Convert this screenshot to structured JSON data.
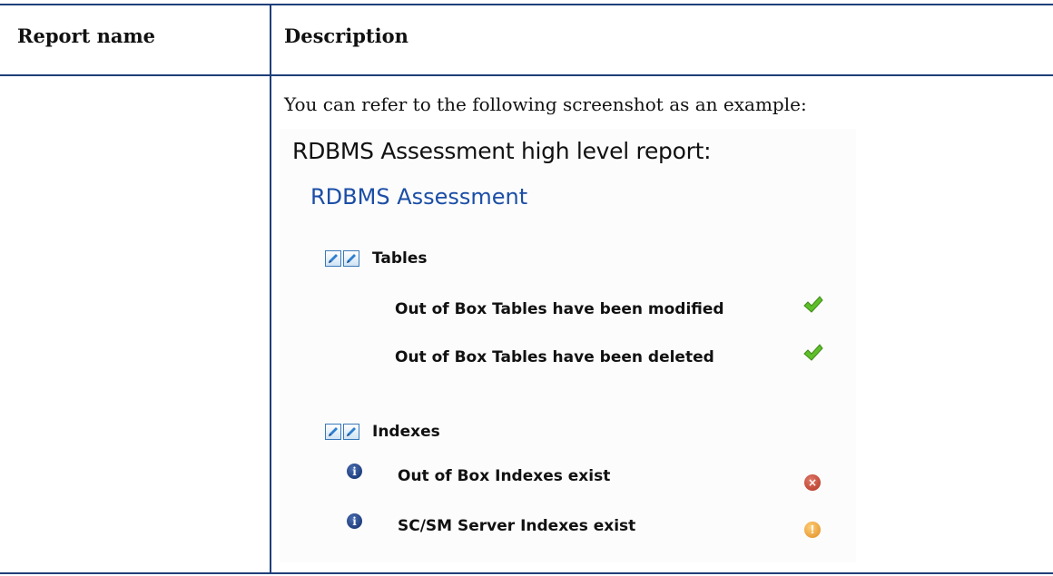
{
  "table": {
    "headers": {
      "report_name": "Report name",
      "description": "Description"
    },
    "intro_text": "You can refer to the following screenshot as an example:"
  },
  "screenshot": {
    "title": "RDBMS Assessment high level report:",
    "heading": "RDBMS Assessment",
    "sections": [
      {
        "label": "Tables",
        "icons": [
          "edit-icon",
          "edit-icon"
        ],
        "items": [
          {
            "label": "Out of Box Tables have been modified",
            "status": "check-icon"
          },
          {
            "label": "Out of Box Tables have been deleted",
            "status": "check-icon"
          }
        ]
      },
      {
        "label": "Indexes",
        "icons": [
          "edit-icon",
          "edit-icon"
        ],
        "items": [
          {
            "label": "Out of Box Indexes exist",
            "lead_icon": "info-icon",
            "status": "error-icon"
          },
          {
            "label": "SC/SM Server Indexes exist",
            "lead_icon": "info-icon",
            "status": "warning-icon"
          }
        ]
      }
    ]
  },
  "colors": {
    "rule": "#1f3f7a",
    "heading_blue": "#1b4ea6",
    "check_green": "#5fbf2a",
    "error_red": "#b23220",
    "warning_orange": "#e08a1e",
    "info_navy": "#0e2a66"
  }
}
